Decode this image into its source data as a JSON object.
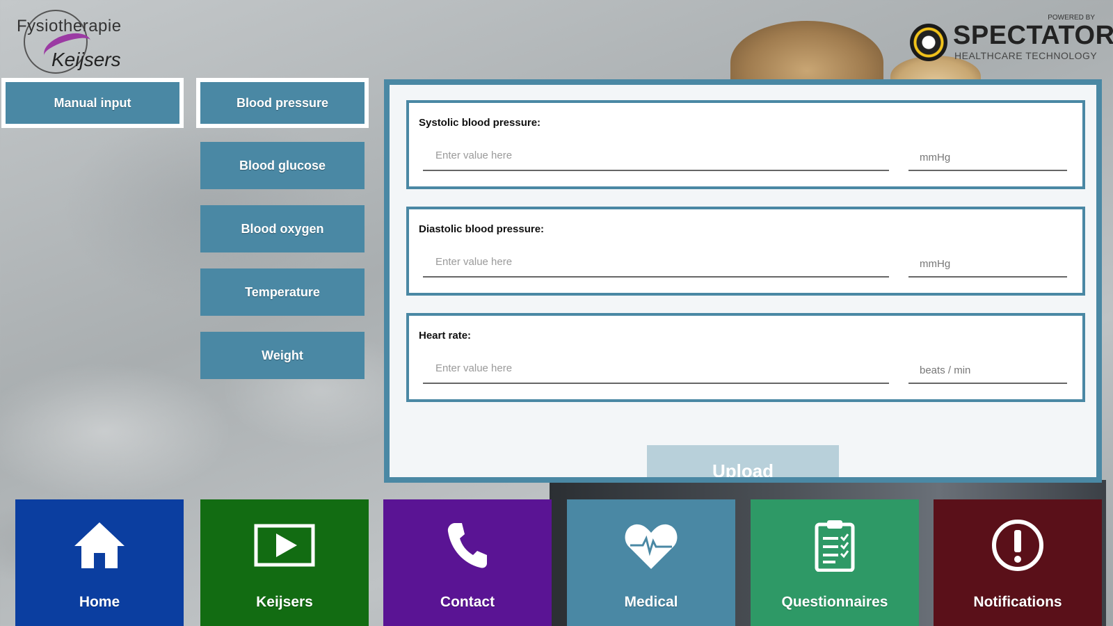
{
  "logo": {
    "line1": "Fysiotherapie",
    "line2": "Keijsers"
  },
  "sponsor": {
    "powered_by": "POWERED BY",
    "name": "SPECTATOR",
    "tagline": "HEALTHCARE TECHNOLOGY"
  },
  "left_menu": {
    "manual_input": "Manual input"
  },
  "measure_menu": {
    "items": [
      {
        "label": "Blood pressure",
        "active": true
      },
      {
        "label": "Blood glucose",
        "active": false
      },
      {
        "label": "Blood oxygen",
        "active": false
      },
      {
        "label": "Temperature",
        "active": false
      },
      {
        "label": "Weight",
        "active": false
      }
    ]
  },
  "form": {
    "fields": [
      {
        "label": "Systolic blood pressure:",
        "placeholder": "Enter value here",
        "unit": "mmHg"
      },
      {
        "label": "Diastolic blood pressure:",
        "placeholder": "Enter value here",
        "unit": "mmHg"
      },
      {
        "label": "Heart rate:",
        "placeholder": "Enter value here",
        "unit": "beats / min"
      }
    ],
    "upload_label": "Upload"
  },
  "bottom_nav": {
    "items": [
      {
        "label": "Home",
        "icon": "home-icon",
        "color": "#0b3ea0"
      },
      {
        "label": "Keijsers",
        "icon": "play-icon",
        "color": "#126c12"
      },
      {
        "label": "Contact",
        "icon": "phone-icon",
        "color": "#5a1494"
      },
      {
        "label": "Medical",
        "icon": "heart-pulse-icon",
        "color": "#4a88a4"
      },
      {
        "label": "Questionnaires",
        "icon": "clipboard-icon",
        "color": "#2e9966"
      },
      {
        "label": "Notifications",
        "icon": "alert-icon",
        "color": "#5a1019"
      }
    ]
  },
  "colors": {
    "accent": "#4a88a4",
    "panel_bg": "#f3f6f8",
    "upload_disabled": "#b8d0da"
  }
}
